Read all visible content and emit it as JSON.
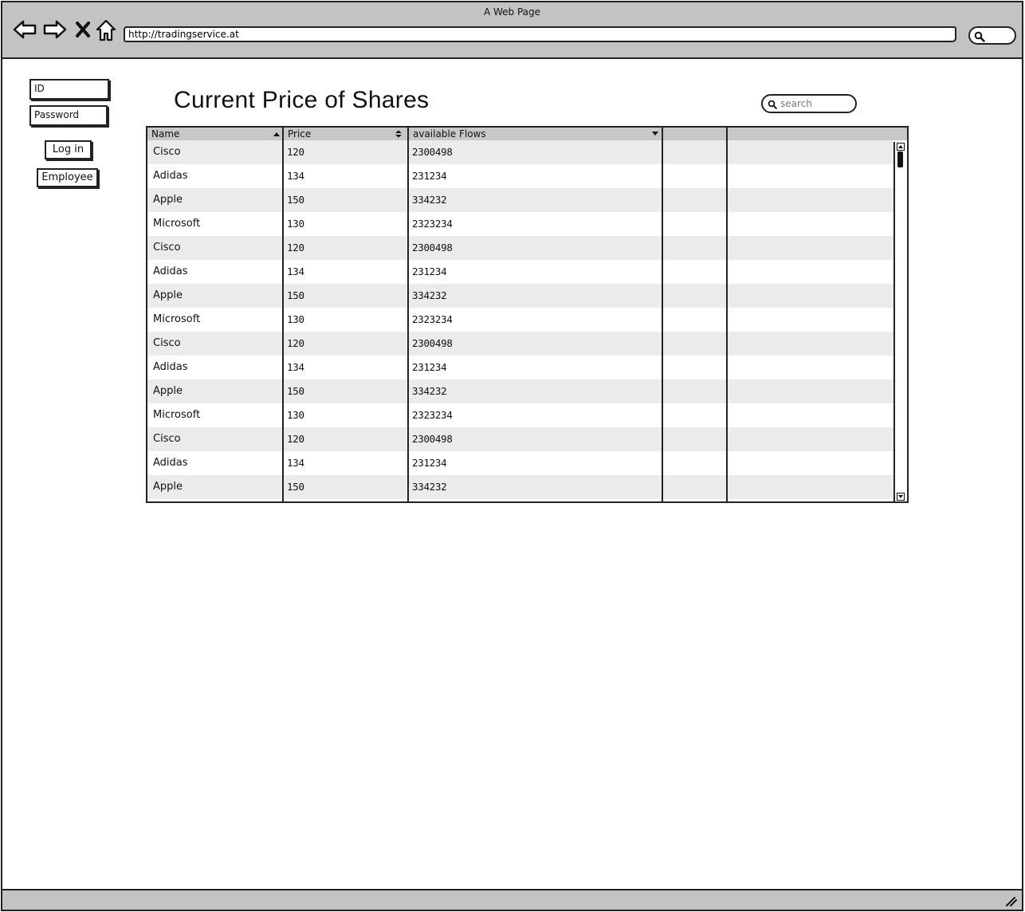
{
  "window": {
    "title": "A Web Page"
  },
  "browser": {
    "url": "http://tradingservice.at",
    "nav_icons": [
      "back-arrow-icon",
      "forward-arrow-icon",
      "close-x-icon",
      "home-icon"
    ],
    "search_icon": "magnifier-icon"
  },
  "login": {
    "id_placeholder": "ID",
    "password_placeholder": "Password",
    "login_label": "Log in",
    "employee_label": "Employee"
  },
  "main": {
    "title": "Current Price of Shares",
    "search_placeholder": "search"
  },
  "table": {
    "columns": [
      {
        "label": "Name",
        "sort": "ascending"
      },
      {
        "label": "Price",
        "sort": "sortable"
      },
      {
        "label": "available Flows",
        "sort": "descending"
      },
      {
        "label": "",
        "sort": "none"
      },
      {
        "label": "",
        "sort": "none"
      }
    ],
    "rows": [
      [
        "Cisco",
        "120",
        "2300498"
      ],
      [
        "Adidas",
        "134",
        "231234"
      ],
      [
        "Apple",
        "150",
        "334232"
      ],
      [
        "Microsoft",
        "130",
        "2323234"
      ],
      [
        "Cisco",
        "120",
        "2300498"
      ],
      [
        "Adidas",
        "134",
        "231234"
      ],
      [
        "Apple",
        "150",
        "334232"
      ],
      [
        "Microsoft",
        "130",
        "2323234"
      ],
      [
        "Cisco",
        "120",
        "2300498"
      ],
      [
        "Adidas",
        "134",
        "231234"
      ],
      [
        "Apple",
        "150",
        "334232"
      ],
      [
        "Microsoft",
        "130",
        "2323234"
      ],
      [
        "Cisco",
        "120",
        "2300498"
      ],
      [
        "Adidas",
        "134",
        "231234"
      ],
      [
        "Apple",
        "150",
        "334232"
      ]
    ]
  },
  "colors": {
    "chrome": "#c3c3c3",
    "row_alt": "#ebebeb",
    "header": "#c8c8c8",
    "stroke": "#222222"
  }
}
